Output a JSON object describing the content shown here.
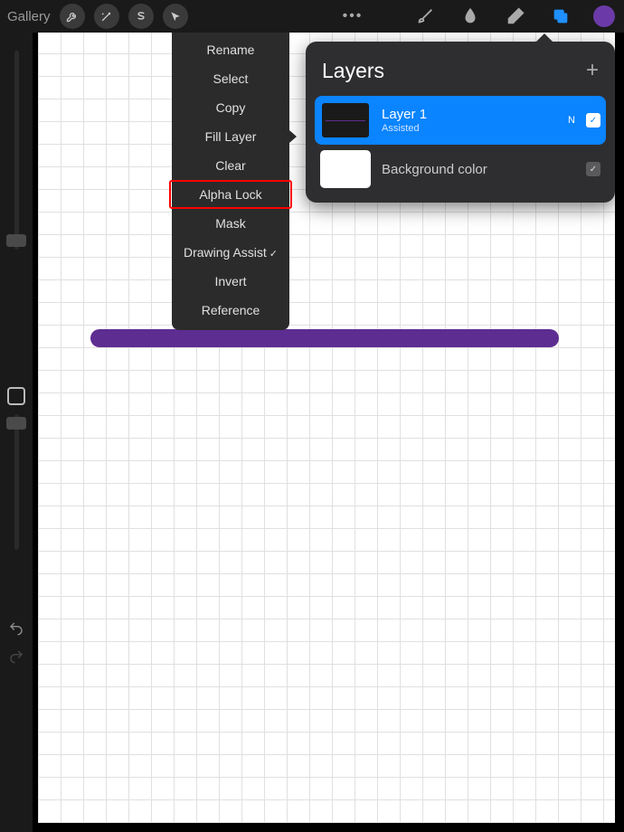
{
  "topbar": {
    "gallery_label": "Gallery",
    "color_swatch": "#6b3aa8"
  },
  "context_menu": {
    "items": [
      {
        "label": "Rename",
        "highlighted": false,
        "check": false
      },
      {
        "label": "Select",
        "highlighted": false,
        "check": false
      },
      {
        "label": "Copy",
        "highlighted": false,
        "check": false
      },
      {
        "label": "Fill Layer",
        "highlighted": false,
        "check": false,
        "pointer": true
      },
      {
        "label": "Clear",
        "highlighted": false,
        "check": false
      },
      {
        "label": "Alpha Lock",
        "highlighted": true,
        "check": false
      },
      {
        "label": "Mask",
        "highlighted": false,
        "check": false
      },
      {
        "label": "Drawing Assist",
        "highlighted": false,
        "check": true
      },
      {
        "label": "Invert",
        "highlighted": false,
        "check": false
      },
      {
        "label": "Reference",
        "highlighted": false,
        "check": false
      }
    ]
  },
  "layers_panel": {
    "title": "Layers",
    "layers": [
      {
        "name": "Layer 1",
        "subtitle": "Assisted",
        "blend_letter": "N"
      },
      {
        "name": "Background color"
      }
    ]
  }
}
